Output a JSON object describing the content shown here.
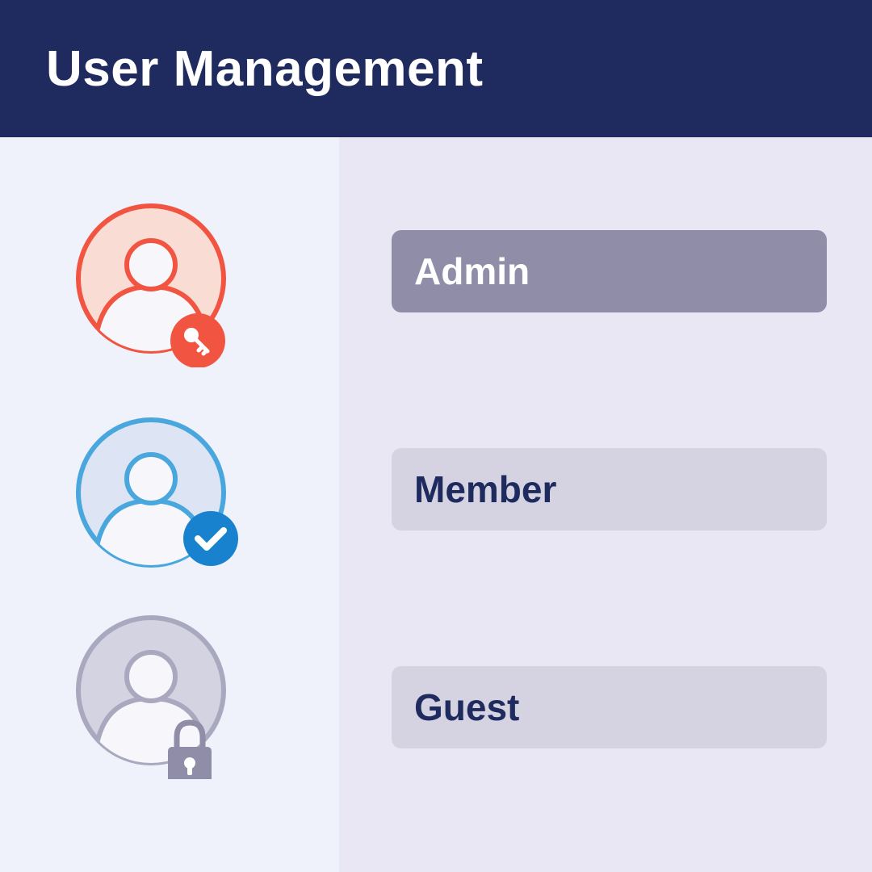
{
  "header": {
    "title": "User Management"
  },
  "colors": {
    "header_bg": "#1f2b5e",
    "admin_accent": "#f25442",
    "member_accent": "#4aa7dd",
    "member_badge": "#1982cf",
    "guest_accent": "#a9a8bf",
    "guest_badge": "#8f8da7",
    "selected_row": "#8f8da7",
    "row": "#d5d3e1",
    "row_text": "#1f2b5e"
  },
  "roles": [
    {
      "label": "Admin",
      "avatar_icon": "user-avatar-icon",
      "badge_icon": "key-icon",
      "selected": true
    },
    {
      "label": "Member",
      "avatar_icon": "user-avatar-icon",
      "badge_icon": "check-icon",
      "selected": false
    },
    {
      "label": "Guest",
      "avatar_icon": "user-avatar-icon",
      "badge_icon": "lock-icon",
      "selected": false
    }
  ]
}
